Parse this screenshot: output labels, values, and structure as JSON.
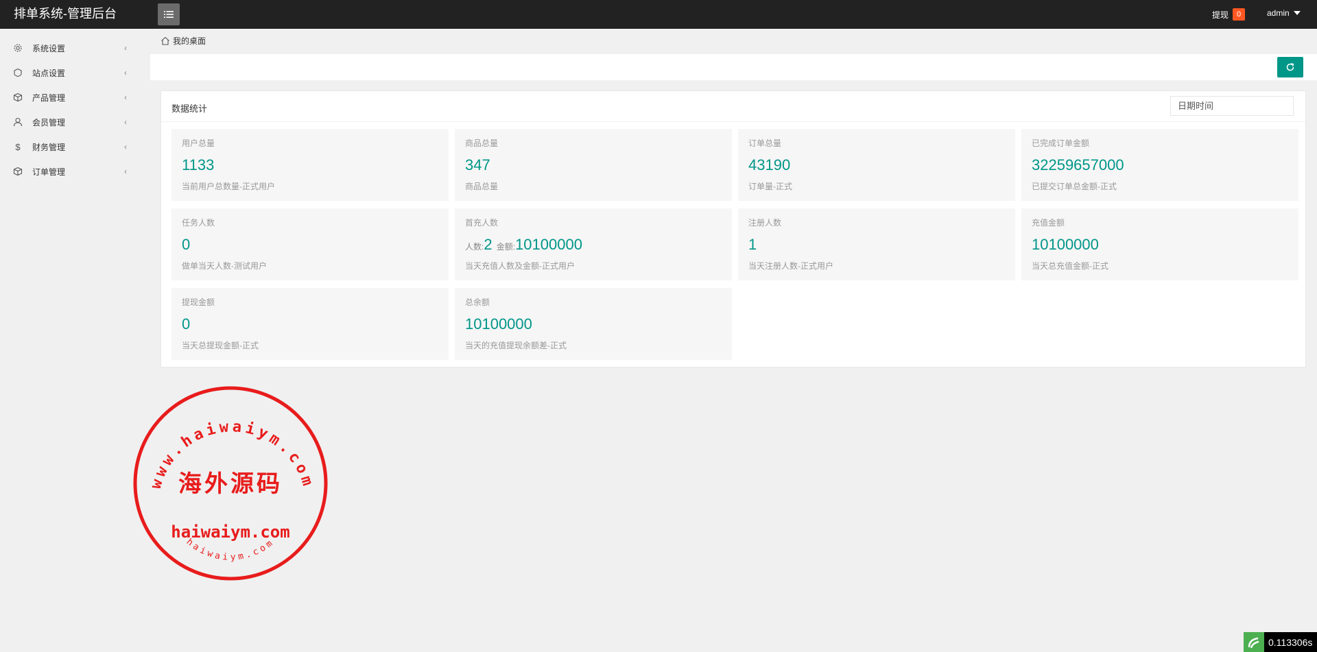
{
  "header": {
    "brand": "排单系统-管理后台",
    "withdraw_label": "提现",
    "withdraw_count": "0",
    "user": "admin"
  },
  "sidebar": {
    "items": [
      {
        "label": "系统设置",
        "icon": "gear-icon"
      },
      {
        "label": "站点设置",
        "icon": "shield-icon"
      },
      {
        "label": "产品管理",
        "icon": "box-icon"
      },
      {
        "label": "会员管理",
        "icon": "user-icon"
      },
      {
        "label": "财务管理",
        "icon": "dollar-icon"
      },
      {
        "label": "订单管理",
        "icon": "box-icon"
      }
    ]
  },
  "breadcrumb": {
    "label": "我的桌面"
  },
  "card": {
    "title": "数据统计",
    "date_placeholder": "日期时间"
  },
  "stats": [
    {
      "label": "用户总量",
      "value": "1133",
      "sub": "当前用户总数量-正式用户"
    },
    {
      "label": "商品总量",
      "value": "347",
      "sub": "商品总量"
    },
    {
      "label": "订单总量",
      "value": "43190",
      "sub": "订单量-正式"
    },
    {
      "label": "已完成订单金额",
      "value": "32259657000",
      "sub": "已提交订单总金额-正式"
    },
    {
      "label": "任务人数",
      "value": "0",
      "sub": "做单当天人数-测试用户"
    },
    {
      "label": "首充人数",
      "count_prefix": "人数:",
      "count": "2",
      "amount_prefix": "金额:",
      "amount": "10100000",
      "sub": "当天充值人数及金额-正式用户"
    },
    {
      "label": "注册人数",
      "value": "1",
      "sub": "当天注册人数-正式用户"
    },
    {
      "label": "充值金额",
      "value": "10100000",
      "sub": "当天总充值金额-正式"
    },
    {
      "label": "提现金额",
      "value": "0",
      "sub": "当天总提现金额-正式"
    },
    {
      "label": "总余额",
      "value": "10100000",
      "sub": "当天的充值提现余额差-正式"
    }
  ],
  "watermark": {
    "ring_text": "www.haiwaiym.com",
    "center_text": "海外源码",
    "domain_text": "haiwaiym.com",
    "bottom_text": "haiwaiym.com"
  },
  "timer": {
    "value": "0.113306s"
  },
  "colors": {
    "accent": "#009688",
    "badge": "#ff5722",
    "header_bg": "#222222",
    "stamp": "#e81c1c"
  }
}
